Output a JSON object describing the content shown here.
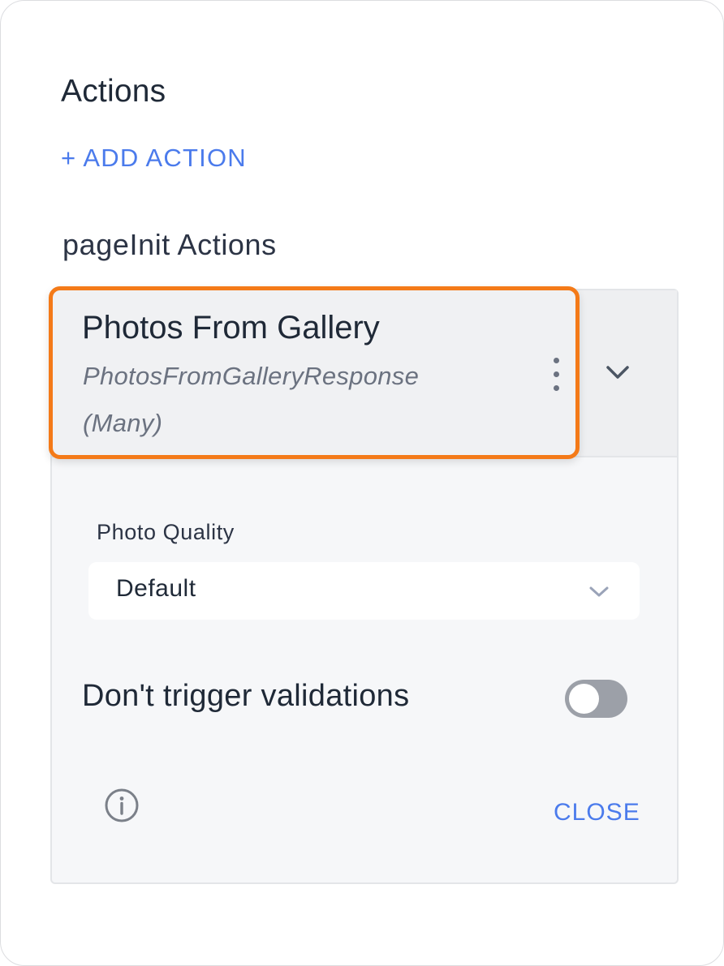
{
  "actions": {
    "title": "Actions",
    "add_action_label": "+ ADD ACTION",
    "subsection_title": "pageInit Actions",
    "items": [
      {
        "name": "Photos From Gallery",
        "response": "PhotosFromGalleryResponse",
        "count": "(Many)"
      }
    ]
  },
  "config": {
    "photo_quality_label": "Photo Quality",
    "photo_quality_value": "Default",
    "toggle_label": "Don't trigger validations",
    "toggle_on": false,
    "close_label": "CLOSE"
  },
  "icons": {
    "kebab": "more-vertical-icon",
    "expand": "chevron-down-icon",
    "select": "chevron-down-icon",
    "info": "info-icon"
  },
  "colors": {
    "accent": "#4b7bec",
    "highlight": "#f47a18",
    "toggle_off": "#9ca0a8"
  }
}
